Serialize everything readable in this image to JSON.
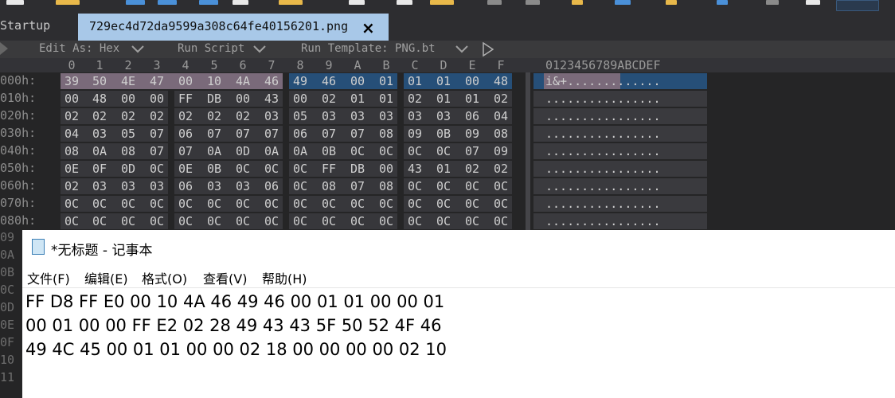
{
  "tabs": {
    "startup": "Startup",
    "file": "729ec4d72da9599a308c64fe40156201.png",
    "close": "×"
  },
  "editor_toolbar": {
    "edit_as": "Edit As: Hex",
    "run_script": "Run Script",
    "run_template": "Run Template: PNG.bt"
  },
  "hex_header": {
    "columns": [
      "0",
      "1",
      "2",
      "3",
      "4",
      "5",
      "6",
      "7",
      "8",
      "9",
      "A",
      "B",
      "C",
      "D",
      "E",
      "F"
    ],
    "ascii_header": "0123456789ABCDEF"
  },
  "hex_rows": [
    {
      "addr": "000h:",
      "bytes": [
        "39",
        "50",
        "4E",
        "47",
        "00",
        "10",
        "4A",
        "46",
        "49",
        "46",
        "00",
        "01",
        "01",
        "01",
        "00",
        "48"
      ],
      "ascii": "i&+............."
    },
    {
      "addr": "010h:",
      "bytes": [
        "00",
        "48",
        "00",
        "00",
        "FF",
        "DB",
        "00",
        "43",
        "00",
        "02",
        "01",
        "01",
        "02",
        "01",
        "01",
        "02"
      ],
      "ascii": "................"
    },
    {
      "addr": "020h:",
      "bytes": [
        "02",
        "02",
        "02",
        "02",
        "02",
        "02",
        "02",
        "03",
        "05",
        "03",
        "03",
        "03",
        "03",
        "03",
        "06",
        "04"
      ],
      "ascii": "................"
    },
    {
      "addr": "030h:",
      "bytes": [
        "04",
        "03",
        "05",
        "07",
        "06",
        "07",
        "07",
        "07",
        "06",
        "07",
        "07",
        "08",
        "09",
        "0B",
        "09",
        "08"
      ],
      "ascii": "................"
    },
    {
      "addr": "040h:",
      "bytes": [
        "08",
        "0A",
        "08",
        "07",
        "07",
        "0A",
        "0D",
        "0A",
        "0A",
        "0B",
        "0C",
        "0C",
        "0C",
        "0C",
        "07",
        "09"
      ],
      "ascii": "................"
    },
    {
      "addr": "050h:",
      "bytes": [
        "0E",
        "0F",
        "0D",
        "0C",
        "0E",
        "0B",
        "0C",
        "0C",
        "0C",
        "FF",
        "DB",
        "00",
        "43",
        "01",
        "02",
        "02"
      ],
      "ascii": "................"
    },
    {
      "addr": "060h:",
      "bytes": [
        "02",
        "03",
        "03",
        "03",
        "06",
        "03",
        "03",
        "06",
        "0C",
        "08",
        "07",
        "08",
        "0C",
        "0C",
        "0C",
        "0C"
      ],
      "ascii": "................"
    },
    {
      "addr": "070h:",
      "bytes": [
        "0C",
        "0C",
        "0C",
        "0C",
        "0C",
        "0C",
        "0C",
        "0C",
        "0C",
        "0C",
        "0C",
        "0C",
        "0C",
        "0C",
        "0C",
        "0C"
      ],
      "ascii": "................"
    },
    {
      "addr": "080h:",
      "bytes": [
        "0C",
        "0C",
        "0C",
        "0C",
        "0C",
        "0C",
        "0C",
        "0C",
        "0C",
        "0C",
        "0C",
        "0C",
        "0C",
        "0C",
        "0C",
        "0C"
      ],
      "ascii": "................"
    }
  ],
  "gutter_labels": [
    "09",
    "0A",
    "0B",
    "0C",
    "0D",
    "0E",
    "0F",
    "10",
    "11"
  ],
  "notepad": {
    "title": "*无标题 - 记事本",
    "menu": [
      "文件(F)",
      "编辑(E)",
      "格式(O)",
      "查看(V)",
      "帮助(H)"
    ],
    "lines": [
      "FF D8 FF E0 00 10 4A 46 49 46 00 01 01 00 00 01",
      "00 01 00 00 FF E2 02 28 49 43 43 5F 50 52 4F 46",
      "49 4C 45 00 01 01 00 00 02 18 00 00 00 00 02 10"
    ]
  },
  "colors": {
    "selection": "#7a6a7a",
    "row_highlight": "#264f78",
    "tab_active": "#a8c8e8"
  }
}
